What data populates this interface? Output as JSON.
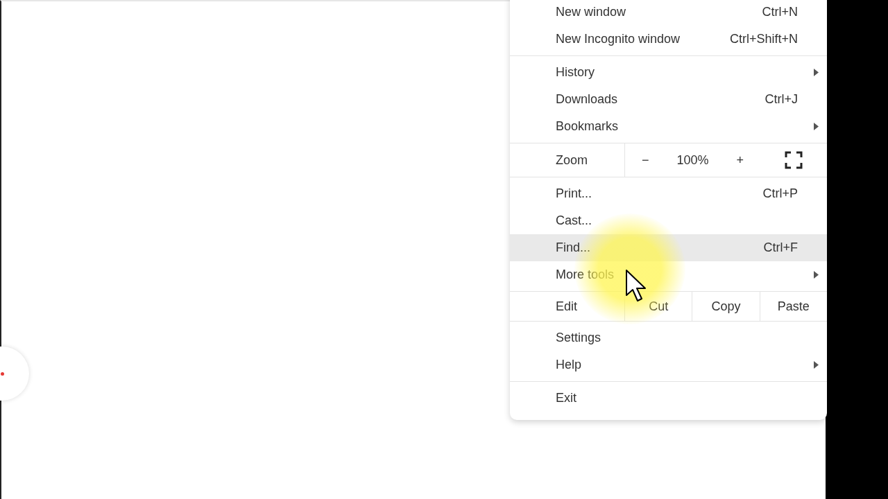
{
  "menu": {
    "sections": [
      {
        "kind": "items",
        "items": [
          {
            "label": "New window",
            "shortcut": "Ctrl+N",
            "submenu": false,
            "selected": false
          },
          {
            "label": "New Incognito window",
            "shortcut": "Ctrl+Shift+N",
            "submenu": false,
            "selected": false
          }
        ]
      },
      {
        "kind": "items",
        "items": [
          {
            "label": "History",
            "submenu": true,
            "selected": false
          },
          {
            "label": "Downloads",
            "shortcut": "Ctrl+J",
            "submenu": false,
            "selected": false
          },
          {
            "label": "Bookmarks",
            "submenu": true,
            "selected": false
          }
        ]
      },
      {
        "kind": "zoom",
        "label": "Zoom",
        "minus": "−",
        "value": "100%",
        "plus": "+"
      },
      {
        "kind": "items",
        "items": [
          {
            "label": "Print...",
            "shortcut": "Ctrl+P",
            "submenu": false,
            "selected": false
          },
          {
            "label": "Cast...",
            "submenu": false,
            "selected": false
          },
          {
            "label": "Find...",
            "shortcut": "Ctrl+F",
            "submenu": false,
            "selected": true
          },
          {
            "label": "More tools",
            "submenu": true,
            "selected": false
          }
        ]
      },
      {
        "kind": "edit",
        "label": "Edit",
        "buttons": [
          "Cut",
          "Copy",
          "Paste"
        ]
      },
      {
        "kind": "items",
        "items": [
          {
            "label": "Settings",
            "submenu": false,
            "selected": false
          },
          {
            "label": "Help",
            "submenu": true,
            "selected": false
          }
        ]
      },
      {
        "kind": "items",
        "items": [
          {
            "label": "Exit",
            "submenu": false,
            "selected": false
          }
        ]
      }
    ]
  }
}
